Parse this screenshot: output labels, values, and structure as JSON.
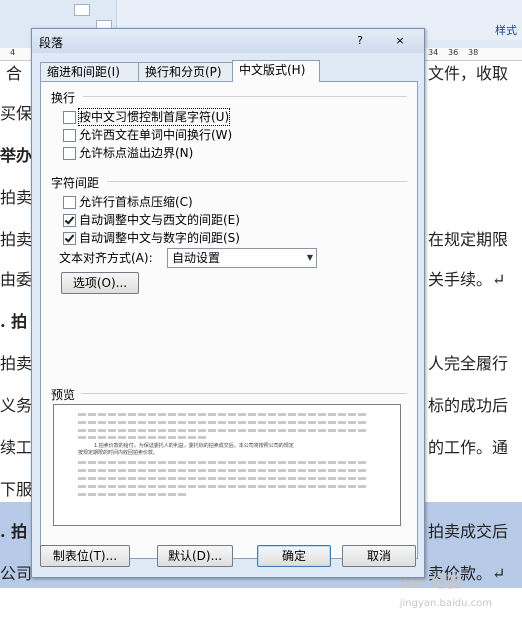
{
  "background": {
    "ribbon_styles_label": "样式",
    "ruler_left": "4",
    "ruler_right": [
      "34",
      "36",
      "38"
    ],
    "lines_left": [
      "合",
      "买保",
      "举办",
      "拍卖",
      "拍卖",
      "由委",
      ". 拍",
      "拍卖",
      "义务",
      "续工",
      "下服",
      ". 拍",
      "公司"
    ],
    "lines_right": [
      "文件，收取",
      "在规定期限",
      "关手续。↵",
      "人完全履行",
      "标的成功后",
      "的工作。通",
      "拍卖成交后",
      "卖价款。↵"
    ],
    "watermark": "Bai 经验",
    "watermark_sub": "jingyan.baidu.com"
  },
  "dialog": {
    "title": "段落",
    "help": "?",
    "close": "×",
    "tabs": [
      "缩进和间距(I)",
      "换行和分页(P)",
      "中文版式(H)"
    ],
    "wrap_section": "换行",
    "wrap_options": [
      {
        "label": "按中文习惯控制首尾字符(U)",
        "checked": false
      },
      {
        "label": "允许西文在单词中间换行(W)",
        "checked": false
      },
      {
        "label": "允许标点溢出边界(N)",
        "checked": false
      }
    ],
    "spacing_section": "字符间距",
    "spacing_options": [
      {
        "label": "允许行首标点压缩(C)",
        "checked": false
      },
      {
        "label": "自动调整中文与西文的间距(E)",
        "checked": true
      },
      {
        "label": "自动调整中文与数字的间距(S)",
        "checked": true
      }
    ],
    "align_label": "文本对齐方式(A):",
    "align_value": "自动设置",
    "options_button": "选项(O)...",
    "preview_label": "预览",
    "preview_text_1": "1.拍卖价款的给付。为保证委托人的利益，委托标的拍卖成交后，本公司将按照公司的规定",
    "preview_text_2": "按规定期限的时间内收回拍卖价款。",
    "buttons": {
      "tabs": "制表位(T)...",
      "default": "默认(D)...",
      "ok": "确定",
      "cancel": "取消"
    }
  }
}
